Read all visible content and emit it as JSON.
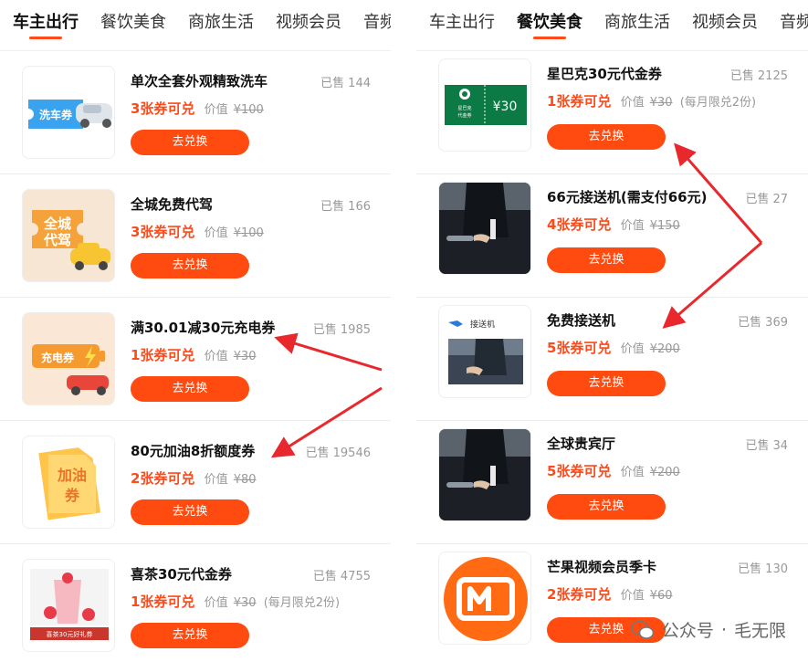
{
  "left_panel": {
    "tabs": [
      {
        "label": "车主出行",
        "active": true
      },
      {
        "label": "餐饮美食",
        "active": false
      },
      {
        "label": "商旅生活",
        "active": false
      },
      {
        "label": "视频会员",
        "active": false
      },
      {
        "label": "音频",
        "active": false
      }
    ],
    "cards": [
      {
        "title": "单次全套外观精致洗车",
        "sold_label": "已售",
        "sold_count": "144",
        "coupons": "3张券可兑",
        "worth_label": "价值",
        "old_price": "¥100",
        "limit": "",
        "button": "去兑换",
        "thumb_text": "洗车券",
        "thumb_icon": "car-wash-coupon-icon"
      },
      {
        "title": "全城免费代驾",
        "sold_label": "已售",
        "sold_count": "166",
        "coupons": "3张券可兑",
        "worth_label": "价值",
        "old_price": "¥100",
        "limit": "",
        "button": "去兑换",
        "thumb_text": "全城代驾",
        "thumb_icon": "chauffeur-coupon-icon"
      },
      {
        "title": "满30.01减30元充电券",
        "sold_label": "已售",
        "sold_count": "1985",
        "coupons": "1张券可兑",
        "worth_label": "价值",
        "old_price": "¥30",
        "limit": "",
        "button": "去兑换",
        "thumb_text": "充电券",
        "thumb_icon": "charging-coupon-icon"
      },
      {
        "title": "80元加油8折额度券",
        "sold_label": "已售",
        "sold_count": "19546",
        "coupons": "2张券可兑",
        "worth_label": "价值",
        "old_price": "¥80",
        "limit": "",
        "button": "去兑换",
        "thumb_text": "加油券",
        "thumb_icon": "fuel-coupon-icon"
      },
      {
        "title": "喜茶30元代金券",
        "sold_label": "已售",
        "sold_count": "4755",
        "coupons": "1张券可兑",
        "worth_label": "价值",
        "old_price": "¥30",
        "limit": "(每月限兑2份)",
        "button": "去兑换",
        "thumb_text": "喜茶30元好礼券",
        "thumb_icon": "heytea-drink-icon"
      }
    ]
  },
  "right_panel": {
    "tabs": [
      {
        "label": "车主出行",
        "active": false
      },
      {
        "label": "餐饮美食",
        "active": true
      },
      {
        "label": "商旅生活",
        "active": false
      },
      {
        "label": "视频会员",
        "active": false
      },
      {
        "label": "音频",
        "active": false
      }
    ],
    "cards": [
      {
        "title": "星巴克30元代金券",
        "sold_label": "已售",
        "sold_count": "2125",
        "coupons": "1张券可兑",
        "worth_label": "价值",
        "old_price": "¥30",
        "limit": "(每月限兑2份)",
        "button": "去兑换",
        "thumb_text": "¥30",
        "thumb_text2": "星巴克代金券",
        "thumb_icon": "starbucks-voucher-icon"
      },
      {
        "title": "66元接送机(需支付66元)",
        "sold_label": "已售",
        "sold_count": "27",
        "coupons": "4张券可兑",
        "worth_label": "价值",
        "old_price": "¥150",
        "limit": "",
        "button": "去兑换",
        "thumb_text": "",
        "thumb_icon": "car-door-photo"
      },
      {
        "title": "免费接送机",
        "sold_label": "已售",
        "sold_count": "369",
        "coupons": "5张券可兑",
        "worth_label": "价值",
        "old_price": "¥200",
        "limit": "",
        "button": "去兑换",
        "thumb_text": "接送机",
        "thumb_icon": "airport-transfer-icon"
      },
      {
        "title": "全球贵宾厅",
        "sold_label": "已售",
        "sold_count": "34",
        "coupons": "5张券可兑",
        "worth_label": "价值",
        "old_price": "¥200",
        "limit": "",
        "button": "去兑换",
        "thumb_text": "",
        "thumb_icon": "car-door-photo"
      },
      {
        "title": "芒果视频会员季卡",
        "sold_label": "已售",
        "sold_count": "130",
        "coupons": "2张券可兑",
        "worth_label": "价值",
        "old_price": "¥60",
        "limit": "",
        "button": "去兑换",
        "thumb_text": "",
        "thumb_icon": "mango-tv-logo"
      }
    ]
  },
  "watermark": {
    "text1": "公众号",
    "dot": "·",
    "text2": "毛无限"
  },
  "colors": {
    "accent": "#ff4a10",
    "arrow": "#e8282c",
    "muted": "#999999"
  }
}
